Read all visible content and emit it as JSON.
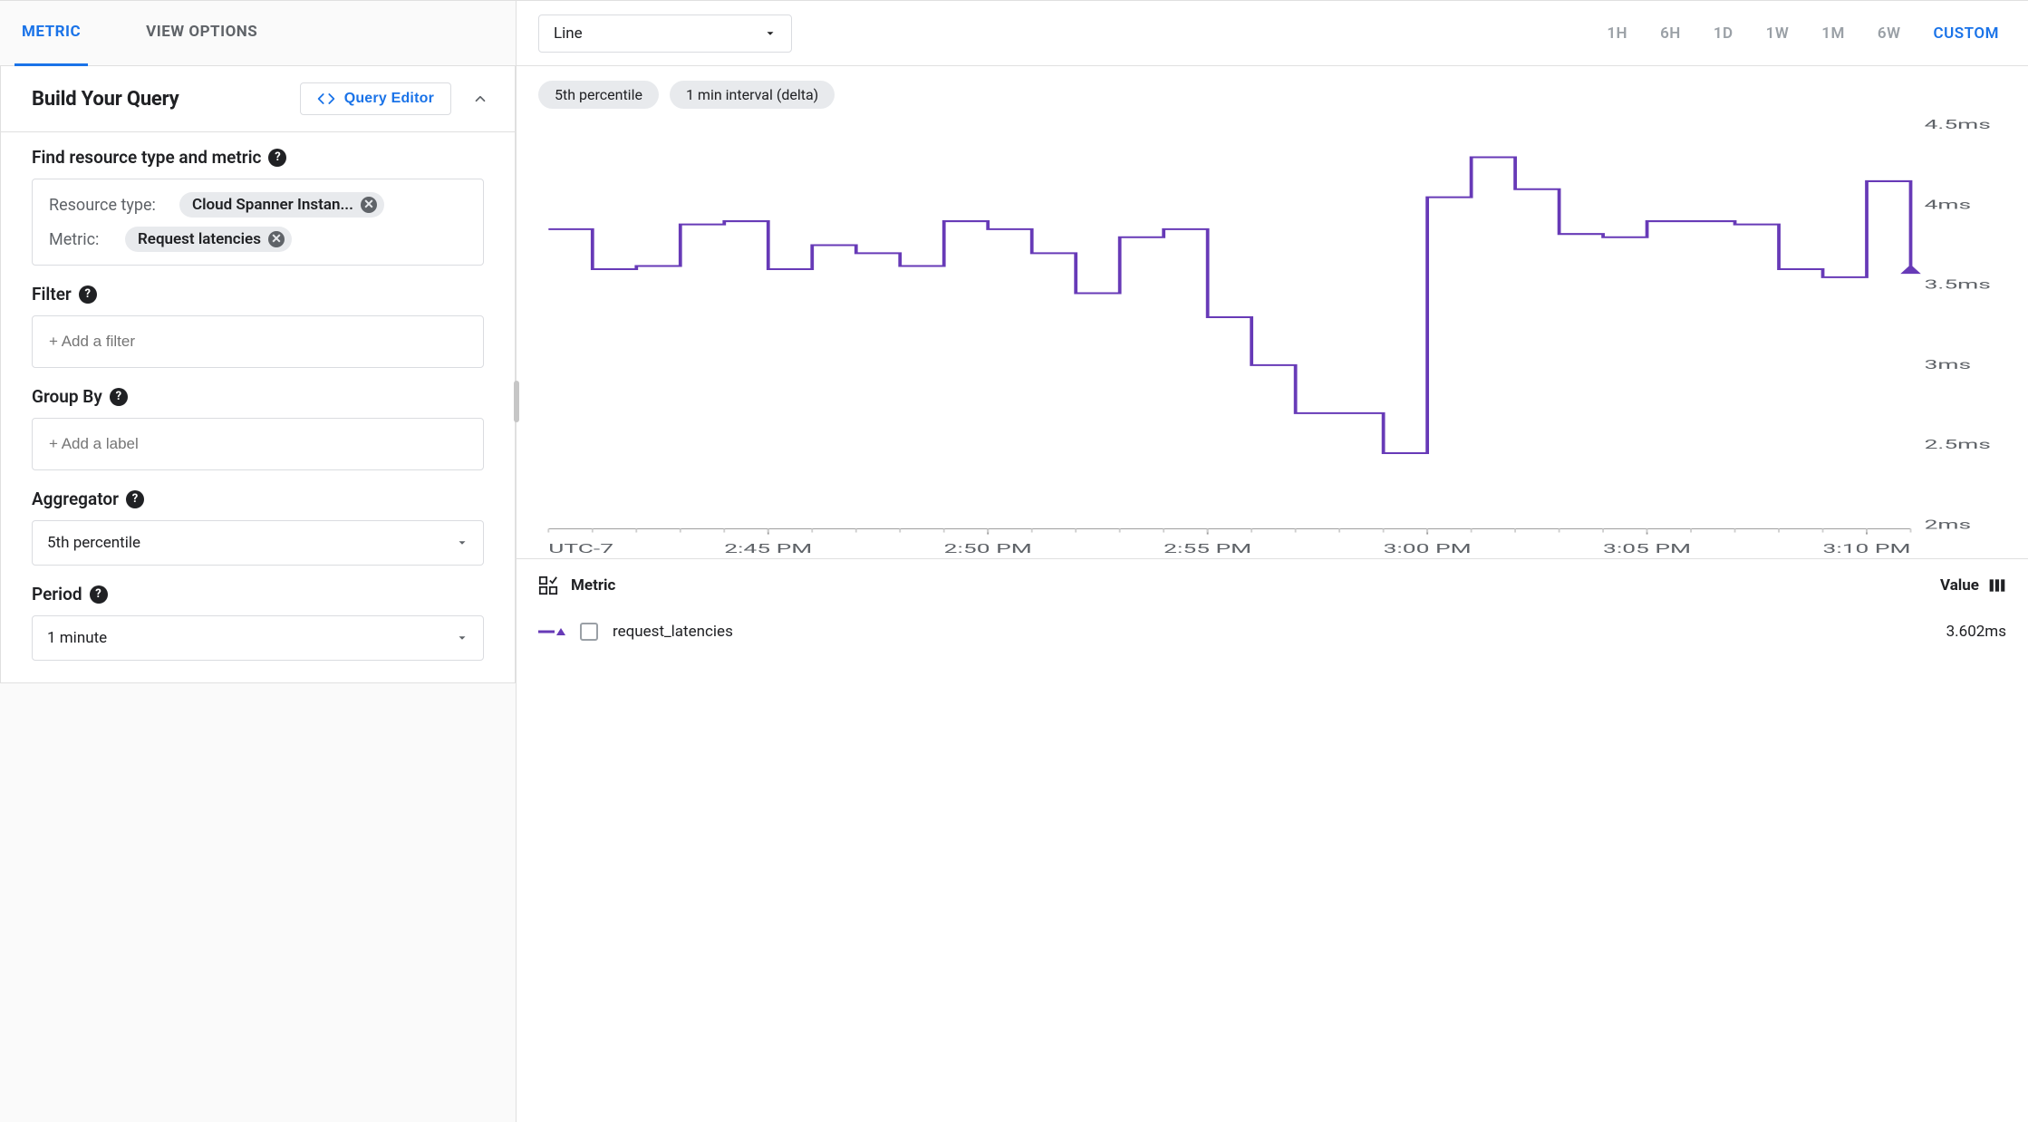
{
  "left": {
    "tabs": {
      "metric": "METRIC",
      "view_options": "VIEW OPTIONS"
    },
    "panel_title": "Build Your Query",
    "query_editor_btn": "Query Editor",
    "find_label": "Find resource type and metric",
    "resource_type_label": "Resource type:",
    "resource_type_chip": "Cloud Spanner Instan...",
    "metric_label": "Metric:",
    "metric_chip": "Request latencies",
    "filter_label": "Filter",
    "filter_placeholder": "+ Add a filter",
    "group_by_label": "Group By",
    "group_by_placeholder": "+ Add a label",
    "aggregator_label": "Aggregator",
    "aggregator_value": "5th percentile",
    "period_label": "Period",
    "period_value": "1 minute"
  },
  "right": {
    "chart_type": "Line",
    "ranges": [
      "1H",
      "6H",
      "1D",
      "1W",
      "1M",
      "6W",
      "CUSTOM"
    ],
    "range_active": "CUSTOM",
    "pills": [
      "5th percentile",
      "1 min interval (delta)"
    ],
    "y_ticks": [
      "4.5ms",
      "4ms",
      "3.5ms",
      "3ms",
      "2.5ms",
      "2ms"
    ],
    "tz": "UTC-7",
    "x_ticks": [
      "2:45 PM",
      "2:50 PM",
      "2:55 PM",
      "3:00 PM",
      "3:05 PM",
      "3:10 PM"
    ],
    "legend_metric_header": "Metric",
    "legend_value_header": "Value",
    "legend_name": "request_latencies",
    "legend_value": "3.602ms"
  },
  "chart_data": {
    "type": "line",
    "title": "",
    "xlabel": "",
    "ylabel": "",
    "ylim": [
      2.0,
      4.5
    ],
    "y_unit": "ms",
    "x_unit": "time (UTC-7)",
    "x": [
      "2:40",
      "2:41",
      "2:42",
      "2:43",
      "2:44",
      "2:45",
      "2:46",
      "2:47",
      "2:48",
      "2:49",
      "2:50",
      "2:51",
      "2:52",
      "2:53",
      "2:54",
      "2:55",
      "2:56",
      "2:57",
      "2:58",
      "2:59",
      "3:00",
      "3:01",
      "3:02",
      "3:03",
      "3:04",
      "3:05",
      "3:06",
      "3:07",
      "3:08",
      "3:09",
      "3:10",
      "3:11"
    ],
    "series": [
      {
        "name": "request_latencies",
        "color": "#673ab7",
        "values": [
          3.85,
          3.6,
          3.62,
          3.88,
          3.9,
          3.6,
          3.75,
          3.7,
          3.62,
          3.9,
          3.85,
          3.7,
          3.45,
          3.8,
          3.85,
          3.3,
          3.0,
          2.7,
          2.7,
          2.45,
          4.05,
          4.3,
          4.1,
          3.82,
          3.8,
          3.9,
          3.9,
          3.88,
          3.6,
          3.55,
          4.15,
          3.6
        ]
      }
    ],
    "legend": [
      "request_latencies"
    ],
    "current_value": "3.602ms"
  }
}
